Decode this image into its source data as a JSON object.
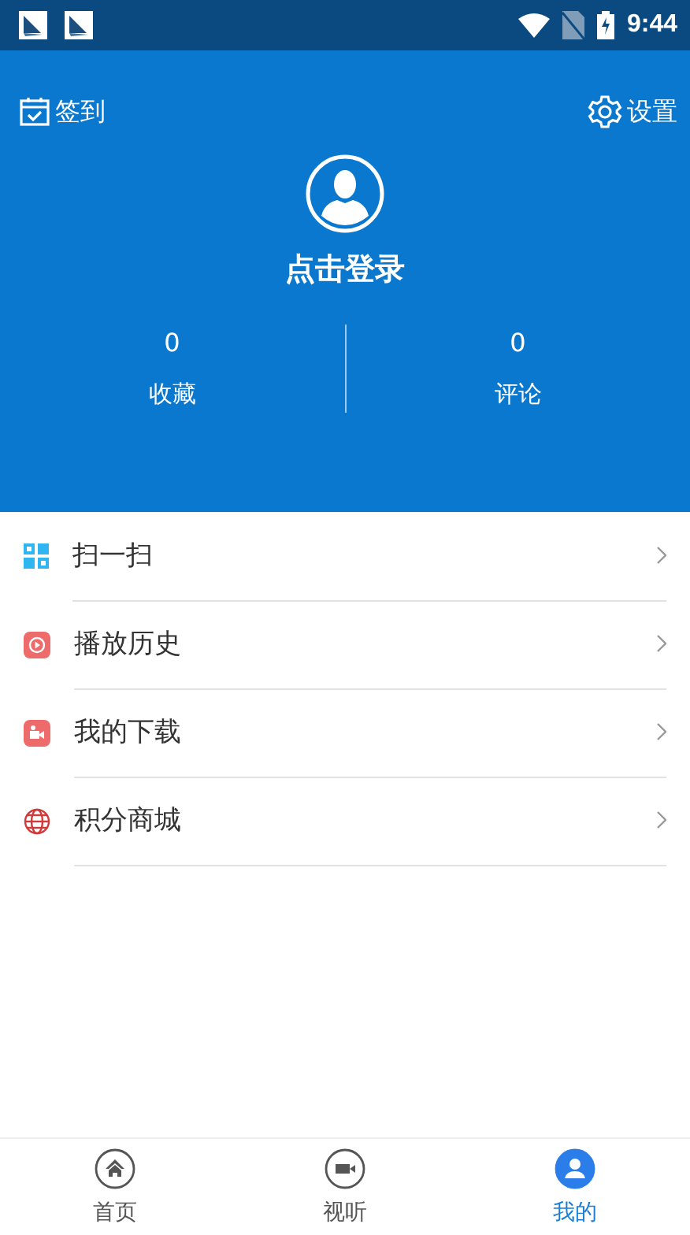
{
  "status_bar": {
    "time": "9:44"
  },
  "header": {
    "checkin": "签到",
    "settings": "设置",
    "login": "点击登录",
    "stats": [
      {
        "value": "0",
        "label": "收藏"
      },
      {
        "value": "0",
        "label": "评论"
      }
    ]
  },
  "menu": [
    {
      "label": "扫一扫"
    },
    {
      "label": "播放历史"
    },
    {
      "label": "我的下载"
    },
    {
      "label": "积分商城"
    }
  ],
  "tabs": [
    {
      "label": "首页",
      "selected": false
    },
    {
      "label": "视听",
      "selected": false
    },
    {
      "label": "我的",
      "selected": true
    }
  ]
}
